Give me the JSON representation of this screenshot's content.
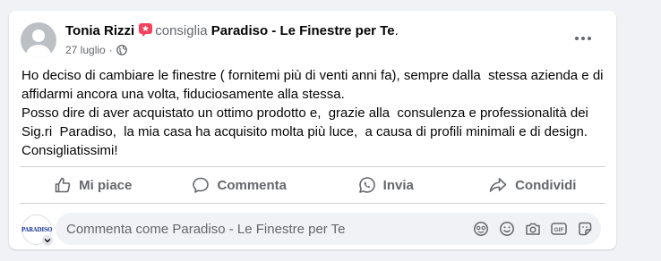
{
  "post": {
    "author": "Tonia Rizzi",
    "verb": "consiglia",
    "page": "Paradiso - Le Finestre per Te",
    "period": ".",
    "date": "27 luglio",
    "meta_separator": "·",
    "audience_icon": "globe-icon",
    "recommend_icon": "recommendation-star-icon",
    "more_icon": "more-dots-icon",
    "text": "Ho deciso di cambiare le finestre ( fornitemi più di venti anni fa), sempre dalla  stessa azienda e di affidarmi ancora una volta, fiduciosamente alla stessa.\nPosso dire di aver acquistato un ottimo prodotto e,  grazie alla  consulenza e professionalità dei Sig.ri  Paradiso,  la mia casa ha acquisito molta più luce,  a causa di profili minimali e di design. Consigliatissimi!"
  },
  "actions": {
    "like": "Mi piace",
    "comment": "Commenta",
    "send": "Invia",
    "share": "Condividi"
  },
  "comment_box": {
    "placeholder": "Commenta come Paradiso - Le Finestre per Te",
    "avatar_logo_text": "PARADISO",
    "tool_icons": [
      "avatar-sticker-icon",
      "emoji-icon",
      "camera-icon",
      "gif-icon",
      "sticker-icon"
    ]
  },
  "colors": {
    "accent_icon_pink": "#f3425f",
    "secondary_text": "#65676b",
    "card_bg": "#ffffff",
    "page_bg": "#f0f2f5"
  }
}
